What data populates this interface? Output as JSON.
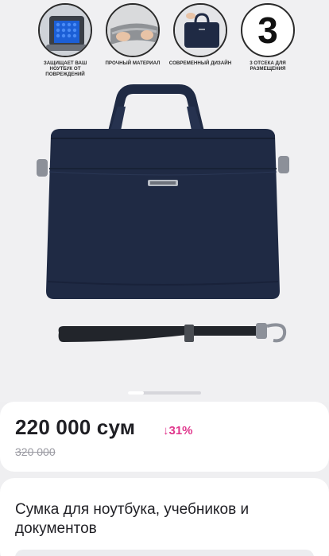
{
  "gallery": {
    "features": [
      {
        "caption": "ЗАЩИЩАЕТ ВАШ НОУТБУК ОТ ПОВРЕЖДЕНИЙ",
        "icon": "laptop-bag-padding-icon"
      },
      {
        "caption": "ПРОЧНЫЙ МАТЕРИАЛ",
        "icon": "fabric-material-icon"
      },
      {
        "caption": "СОВРЕМЕННЫЙ ДИЗАЙН",
        "icon": "bag-design-icon"
      },
      {
        "caption": "3 ОТСЕКА ДЛЯ РАЗМЕЩЕНИЯ",
        "number": "3",
        "icon": "number-three-icon"
      }
    ],
    "carousel": {
      "total_slides": 5,
      "active_slide": 1
    },
    "colors": {
      "bag": "#1f2a44",
      "strap": "#22252b"
    }
  },
  "price": {
    "current": "220 000 сум",
    "discount": "↓31%",
    "old": "320 000",
    "discount_color": "#e0368c"
  },
  "product": {
    "title": "Сумка для ноутбука, учебников и документов"
  }
}
